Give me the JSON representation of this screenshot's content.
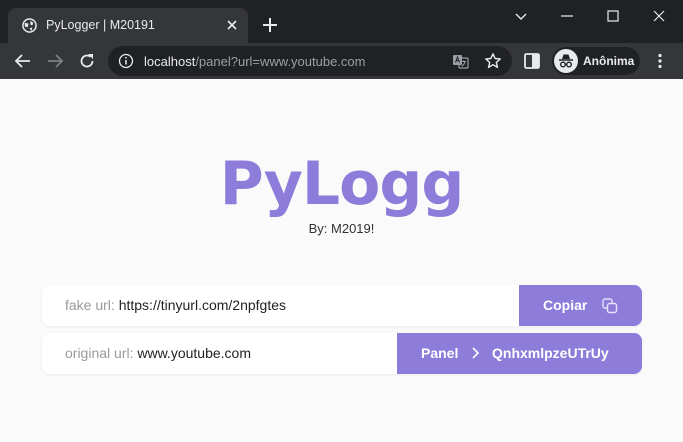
{
  "tab": {
    "title": "PyLogger | M20191"
  },
  "address_bar": {
    "host": "localhost",
    "path": "/panel?url=www.youtube.com"
  },
  "profile": {
    "label": "Anônima"
  },
  "page": {
    "logo": "PyLogg",
    "byline": "By: M2019!",
    "fake_url": {
      "label": "fake url:",
      "value": "https://tinyurl.com/2npfgtes",
      "button": "Copiar"
    },
    "original_url": {
      "label": "original url:",
      "value": "www.youtube.com",
      "button": "Panel",
      "code": "QnhxmlpzeUTrUy"
    }
  },
  "colors": {
    "accent": "#8d7cd9",
    "chrome_dark": "#202124",
    "chrome_mid": "#35363a",
    "page_bg": "#fafafa"
  },
  "icons": [
    "globe-icon",
    "close-icon",
    "plus-icon",
    "chevron-down-icon",
    "minimize-icon",
    "maximize-icon",
    "back-arrow-icon",
    "forward-arrow-icon",
    "reload-icon",
    "info-icon",
    "translate-icon",
    "star-icon",
    "side-panel-icon",
    "incognito-icon",
    "more-vert-icon",
    "copy-icon",
    "chevron-right-icon"
  ]
}
